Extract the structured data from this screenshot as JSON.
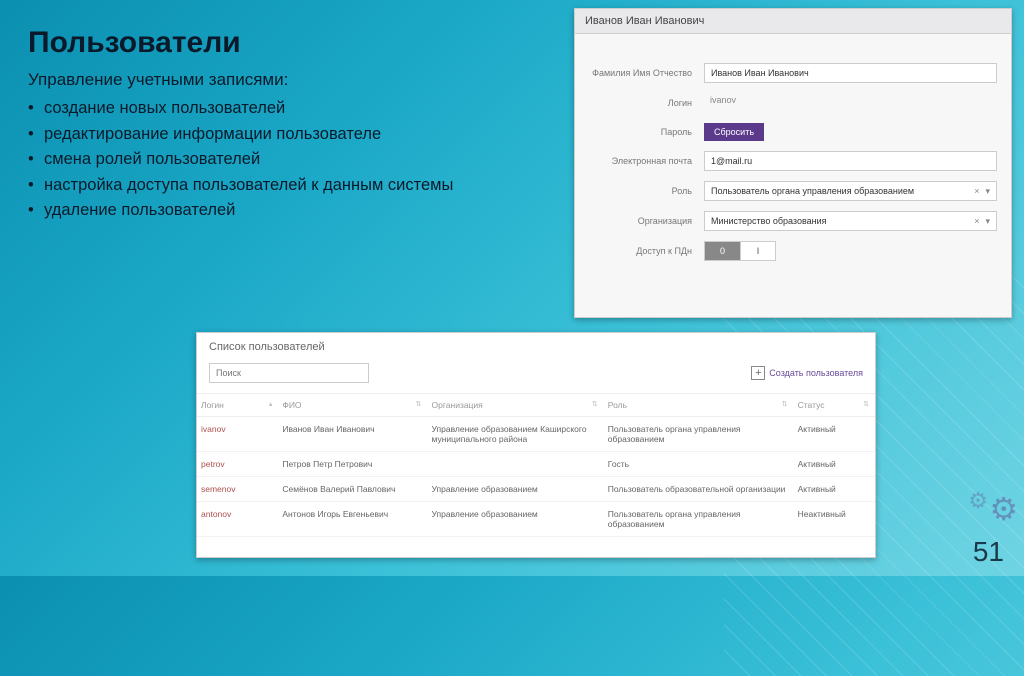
{
  "slide": {
    "title": "Пользователи",
    "subtitle": "Управление учетными записями:",
    "bullets": [
      "создание новых пользователей",
      "редактирование информации пользователе",
      "смена ролей пользователей",
      "настройка доступа пользователей к данным системы",
      "удаление пользователей"
    ],
    "page": "51"
  },
  "edit": {
    "header": "Иванов Иван Иванович",
    "labels": {
      "fio": "Фамилия Имя Отчество",
      "login": "Логин",
      "password": "Пароль",
      "email": "Электронная почта",
      "role": "Роль",
      "org": "Организация",
      "pdn": "Доступ к ПДн"
    },
    "values": {
      "fio": "Иванов Иван Иванович",
      "login": "ivanov",
      "reset_btn": "Сбросить",
      "email": "1@mail.ru",
      "role": "Пользователь органа управления образованием",
      "org": "Министерство образования",
      "toggle_on": "0",
      "toggle_off": "I"
    }
  },
  "list": {
    "title": "Список пользователей",
    "search_placeholder": "Поиск",
    "create_label": "Создать пользователя",
    "columns": {
      "login": "Логин",
      "fio": "ФИО",
      "org": "Организация",
      "role": "Роль",
      "status": "Статус"
    },
    "rows": [
      {
        "login": "ivanov",
        "fio": "Иванов Иван Иванович",
        "org": "Управление образованием Каширского муниципального района",
        "role": "Пользователь органа управления образованием",
        "status": "Активный"
      },
      {
        "login": "petrov",
        "fio": "Петров Петр Петрович",
        "org": "",
        "role": "Гость",
        "status": "Активный"
      },
      {
        "login": "semenov",
        "fio": "Семёнов Валерий Павлович",
        "org": "Управление образованием",
        "role": "Пользователь образовательной организации",
        "status": "Активный"
      },
      {
        "login": "antonov",
        "fio": "Антонов Игорь Евгеньевич",
        "org": "Управление образованием",
        "role": "Пользователь органа управления образованием",
        "status": "Неактивный"
      }
    ]
  }
}
